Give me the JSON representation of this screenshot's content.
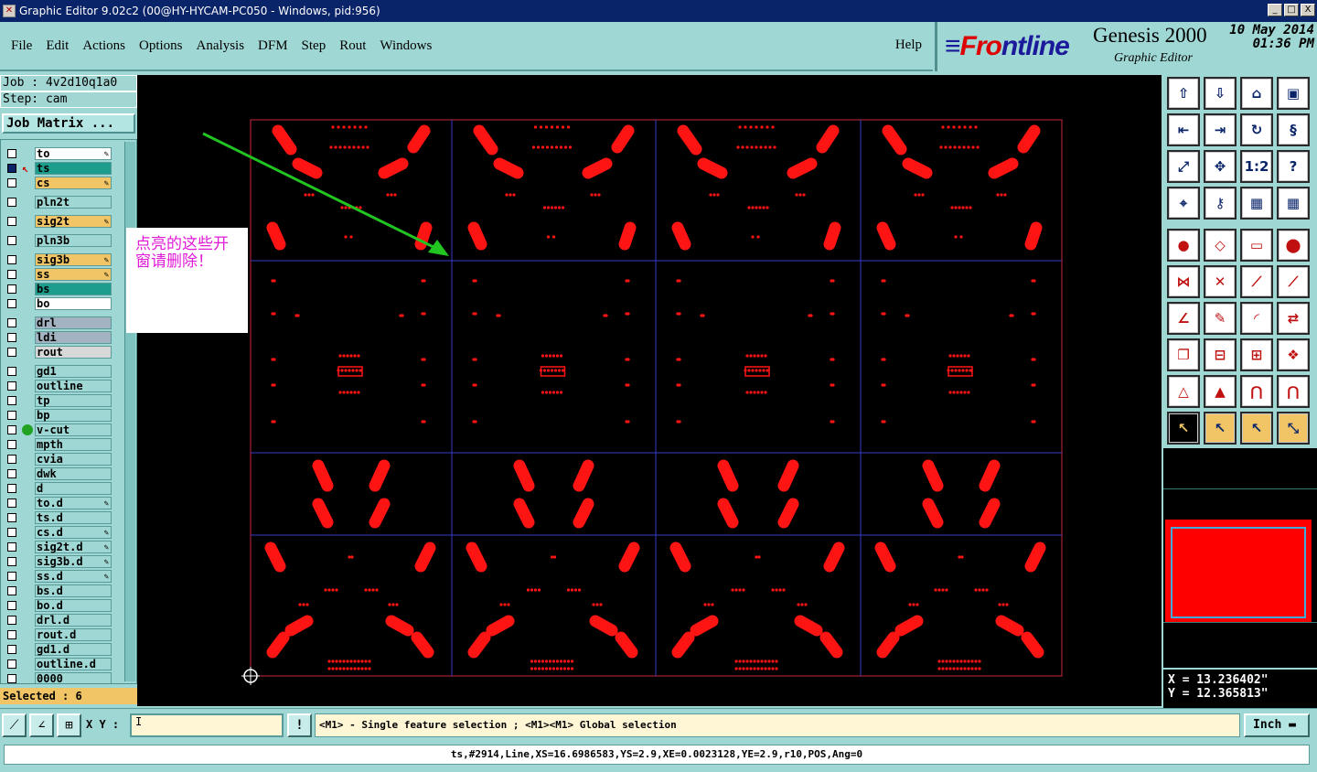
{
  "window": {
    "title": "Graphic Editor 9.02c2 (00@HY-HYCAM-PC050 - Windows, pid:956)",
    "minimize": "_",
    "maximize": "□",
    "close": "X"
  },
  "menu": [
    "File",
    "Edit",
    "Actions",
    "Options",
    "Analysis",
    "DFM",
    "Step",
    "Rout",
    "Windows"
  ],
  "help": "Help",
  "brand": {
    "logo_prefix": "F",
    "logo_accent": "r",
    "logo_o": "o",
    "logo_rest": "ntline",
    "product": "Genesis 2000",
    "subtitle": "Graphic Editor",
    "date": "10 May 2014",
    "time": "01:36 PM"
  },
  "job": {
    "job_line": "Job : 4v2d10q1a0",
    "step_line": "Step: cam",
    "matrix_button": "Job Matrix ..."
  },
  "layers": [
    {
      "name": "to",
      "color": "#ffffff",
      "pen": true
    },
    {
      "name": "ts",
      "color": "#1d9e8c",
      "pen": false,
      "selected": true,
      "pointer": true
    },
    {
      "name": "cs",
      "color": "#f1c566",
      "pen": true
    },
    {
      "name": "pln2t",
      "color": "#9fd7d4",
      "gap": true
    },
    {
      "name": "sig2t",
      "color": "#f1c566",
      "pen": true,
      "gap": true
    },
    {
      "name": "pln3b",
      "color": "#9fd7d4",
      "gap": true
    },
    {
      "name": "sig3b",
      "color": "#f1c566",
      "pen": true,
      "gap": true
    },
    {
      "name": "ss",
      "color": "#f1c566",
      "pen": true
    },
    {
      "name": "bs",
      "color": "#1d9e8c"
    },
    {
      "name": "bo",
      "color": "#ffffff"
    },
    {
      "name": "drl",
      "color": "#a3b3c2",
      "gap": true
    },
    {
      "name": "ldi",
      "color": "#a3b3c2"
    },
    {
      "name": "rout",
      "color": "#d8d8d8"
    },
    {
      "name": "gd1",
      "color": "#9fd7d4",
      "gap": true
    },
    {
      "name": "outline",
      "color": "#9fd7d4"
    },
    {
      "name": "tp",
      "color": "#9fd7d4"
    },
    {
      "name": "bp",
      "color": "#9fd7d4"
    },
    {
      "name": "v-cut",
      "color": "#9fd7d4",
      "dot": true
    },
    {
      "name": "mpth",
      "color": "#9fd7d4"
    },
    {
      "name": "cvia",
      "color": "#9fd7d4"
    },
    {
      "name": "dwk",
      "color": "#9fd7d4"
    },
    {
      "name": "d",
      "color": "#9fd7d4"
    },
    {
      "name": "to.d",
      "color": "#9fd7d4",
      "pen": true
    },
    {
      "name": "ts.d",
      "color": "#9fd7d4"
    },
    {
      "name": "cs.d",
      "color": "#9fd7d4",
      "pen": true
    },
    {
      "name": "sig2t.d",
      "color": "#9fd7d4",
      "pen": true
    },
    {
      "name": "sig3b.d",
      "color": "#9fd7d4",
      "pen": true
    },
    {
      "name": "ss.d",
      "color": "#9fd7d4",
      "pen": true
    },
    {
      "name": "bs.d",
      "color": "#9fd7d4"
    },
    {
      "name": "bo.d",
      "color": "#9fd7d4"
    },
    {
      "name": "drl.d",
      "color": "#9fd7d4"
    },
    {
      "name": "rout.d",
      "color": "#9fd7d4"
    },
    {
      "name": "gd1.d",
      "color": "#9fd7d4"
    },
    {
      "name": "outline.d",
      "color": "#9fd7d4"
    },
    {
      "name": "0000",
      "color": "#9fd7d4"
    }
  ],
  "selected_count": "Selected : 6",
  "annotation": "点亮的这些开窗请删除！",
  "coords": {
    "x": "X = 13.236402\"",
    "y": "Y = 12.365813\""
  },
  "cmd": {
    "xy_label": "X Y :",
    "xy_value": "I",
    "message": "<M1> - Single feature selection ; <M1><M1> Global selection",
    "unit": "Inch",
    "alert": "!"
  },
  "status": "ts,#2914,Line,XS=16.6986583,YS=2.9,XE=0.0023128,YE=2.9,r10,POS,Ang=0",
  "tool_icons": [
    "home-icon",
    "pan-down-icon",
    "zoom-home-icon",
    "zoom-window-icon",
    "zoom-out-icon",
    "zoom-in-icon",
    "redraw-icon",
    "snap-icon",
    "fit-icon",
    "center-icon",
    "ratio-icon",
    "help-icon",
    "measure-icon",
    "key-icon",
    "layers-icon",
    "layers2-icon",
    "pad-icon",
    "polygon-icon",
    "ruler-icon",
    "circle-icon",
    "node-icon",
    "cross-icon",
    "line-icon",
    "line2-icon",
    "angle-icon",
    "pen-icon",
    "arc-icon",
    "mirror-icon",
    "copy-icon",
    "split-icon",
    "grid-icon",
    "group-icon",
    "triangle-icon",
    "triangle2-icon",
    "arch-icon",
    "arch2-icon",
    "select-icon",
    "select2-icon",
    "select3-icon",
    "select4-icon"
  ],
  "colors": {
    "feature": "#ff1414",
    "profile": "#c8283c",
    "grid": "#3a3ac8",
    "arrow": "#22c422"
  }
}
